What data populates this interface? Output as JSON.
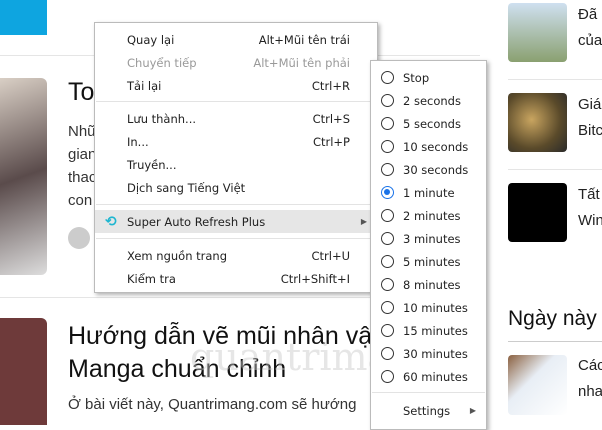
{
  "page": {
    "article1": {
      "title": "To",
      "lines": [
        "Nhữ",
        "gian",
        "thac",
        "con"
      ]
    },
    "article2": {
      "title_lines": [
        "Hướng dẫn vẽ mũi nhân vật",
        "Manga chuẩn chỉnh"
      ],
      "excerpt": "Ở bài viết này, Quantrimang.com sẽ hướng"
    },
    "sidebar": {
      "items": [
        {
          "lines": [
            "Đã",
            "của"
          ]
        },
        {
          "lines": [
            "Giá",
            "Bitc"
          ]
        },
        {
          "lines": [
            "Tất",
            "Win"
          ]
        }
      ],
      "section_title": "Ngày này",
      "section_item": [
        "Các",
        "nha"
      ]
    },
    "watermark": "quantrimang"
  },
  "context_menu": {
    "items": [
      {
        "label": "Quay lại",
        "shortcut": "Alt+Mũi tên trái"
      },
      {
        "label": "Chuyển tiếp",
        "shortcut": "Alt+Mũi tên phải",
        "disabled": true
      },
      {
        "label": "Tải lại",
        "shortcut": "Ctrl+R"
      },
      {
        "label": "Lưu thành...",
        "shortcut": "Ctrl+S"
      },
      {
        "label": "In...",
        "shortcut": "Ctrl+P"
      },
      {
        "label": "Truyền...",
        "shortcut": ""
      },
      {
        "label": "Dịch sang Tiếng Việt",
        "shortcut": ""
      },
      {
        "label": "Super Auto Refresh Plus",
        "shortcut": "",
        "icon": "refresh-clock-icon"
      },
      {
        "label": "Xem nguồn trang",
        "shortcut": "Ctrl+U"
      },
      {
        "label": "Kiểm tra",
        "shortcut": "Ctrl+Shift+I"
      }
    ]
  },
  "submenu": {
    "options": [
      "Stop",
      "2 seconds",
      "5 seconds",
      "10 seconds",
      "30 seconds",
      "1 minute",
      "2 minutes",
      "3 minutes",
      "5 minutes",
      "8 minutes",
      "10 minutes",
      "15 minutes",
      "30 minutes",
      "60 minutes"
    ],
    "selected": "1 minute",
    "settings": "Settings"
  },
  "colors": {
    "accent": "#1a73e8",
    "brand": "#0ea5e0"
  }
}
